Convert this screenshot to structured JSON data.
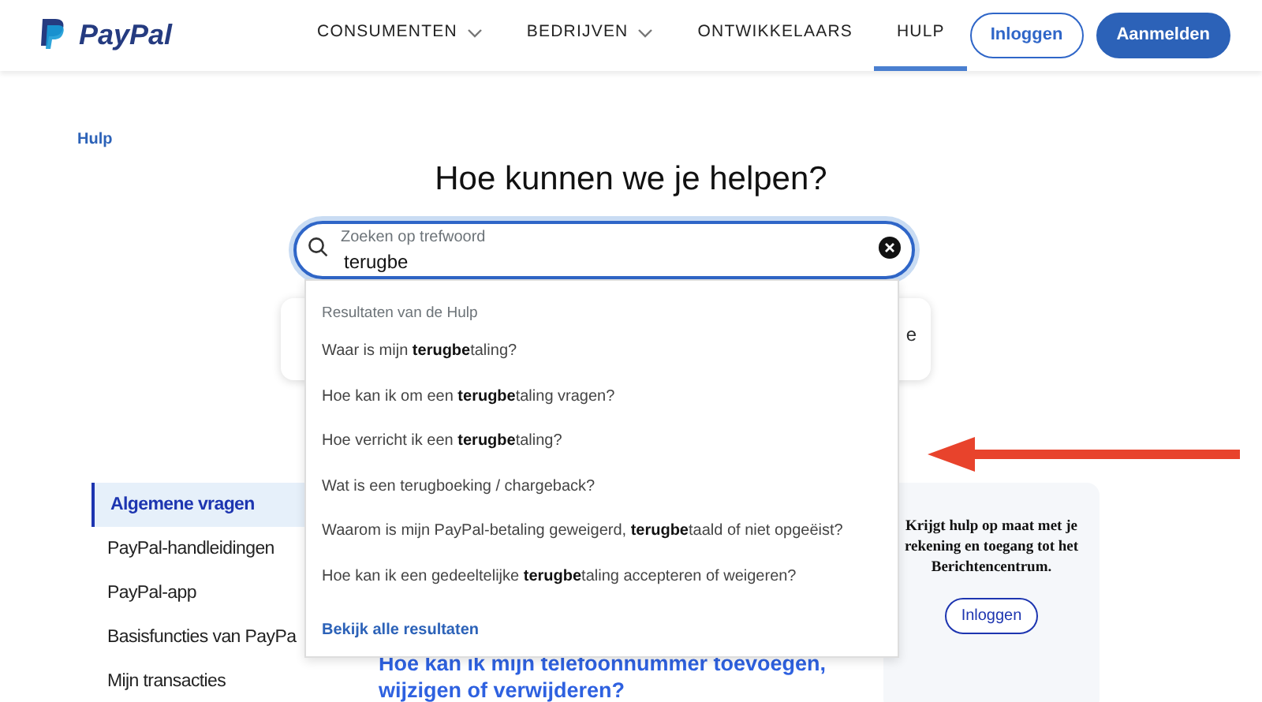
{
  "header": {
    "logo": "PayPal",
    "nav": [
      {
        "label": "CONSUMENTEN",
        "dropdown": true,
        "selected": false
      },
      {
        "label": "BEDRIJVEN",
        "dropdown": true,
        "selected": false
      },
      {
        "label": "ONTWIKKELAARS",
        "dropdown": false,
        "selected": false
      },
      {
        "label": "HULP",
        "dropdown": false,
        "selected": true
      }
    ],
    "login": "Inloggen",
    "signup": "Aanmelden"
  },
  "breadcrumb": "Hulp",
  "heading": "Hoe kunnen we je helpen?",
  "search": {
    "label": "Zoeken op trefwoord",
    "value": "terugbe"
  },
  "behind_card": {
    "text": "e"
  },
  "suggestions": {
    "heading": "Resultaten van de Hulp",
    "items": [
      "Waar is mijn **terugbe**taling?",
      "Hoe kan ik om een **terugbe**taling vragen?",
      "Hoe verricht ik een **terugbe**taling?",
      "Wat is een terugboeking / chargeback?",
      "Waarom is mijn PayPal-betaling geweigerd, **terugbe**taald of niet opgeëist?",
      "Hoe kan ik een gedeeltelijke **terugbe**taling accepteren of weigeren?"
    ],
    "all": "Bekijk alle resultaten"
  },
  "sidebar": [
    {
      "label": "Algemene vragen",
      "selected": true
    },
    {
      "label": "PayPal-handleidingen",
      "selected": false
    },
    {
      "label": "PayPal-app",
      "selected": false
    },
    {
      "label": "Basisfuncties van PayPa",
      "selected": false
    },
    {
      "label": "Mijn transacties",
      "selected": false
    }
  ],
  "article_link": "Hoe kan ik mijn telefoonnummer toevoegen, wijzigen of verwijderen?",
  "login_card": {
    "text": "Krijgt hulp op maat met je rekening en toegang tot het Berichtencentrum.",
    "button": "Inloggen"
  }
}
